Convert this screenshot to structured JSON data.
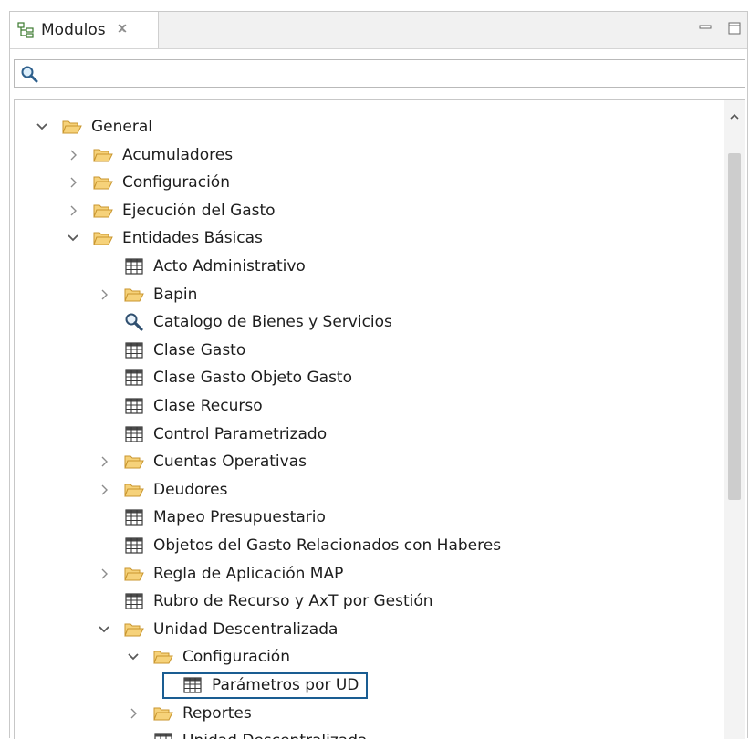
{
  "view": {
    "tab_label": "Modulos",
    "tab_icon": "hierarchy-icon",
    "minimize_icon": "minimize-icon",
    "maximize_icon": "maximize-icon",
    "close_icon": "close-x-icon"
  },
  "search": {
    "value": "",
    "placeholder": "",
    "icon": "magnifier-icon"
  },
  "tree": {
    "nodes": [
      {
        "label": "General",
        "level": 0,
        "icon": "folder-open-icon",
        "expander": "expanded"
      },
      {
        "label": "Acumuladores",
        "level": 1,
        "icon": "folder-open-icon",
        "expander": "collapsed"
      },
      {
        "label": "Configuración",
        "level": 1,
        "icon": "folder-open-icon",
        "expander": "collapsed"
      },
      {
        "label": "Ejecución del Gasto",
        "level": 1,
        "icon": "folder-open-icon",
        "expander": "collapsed"
      },
      {
        "label": "Entidades Básicas",
        "level": 1,
        "icon": "folder-open-icon",
        "expander": "expanded"
      },
      {
        "label": "Acto Administrativo",
        "level": 2,
        "icon": "table-icon",
        "expander": "none"
      },
      {
        "label": "Bapin",
        "level": 2,
        "icon": "folder-open-icon",
        "expander": "collapsed"
      },
      {
        "label": "Catalogo de Bienes y Servicios",
        "level": 2,
        "icon": "search-catalog-icon",
        "expander": "none"
      },
      {
        "label": "Clase Gasto",
        "level": 2,
        "icon": "table-icon",
        "expander": "none"
      },
      {
        "label": "Clase Gasto Objeto Gasto",
        "level": 2,
        "icon": "table-icon",
        "expander": "none"
      },
      {
        "label": "Clase Recurso",
        "level": 2,
        "icon": "table-icon",
        "expander": "none"
      },
      {
        "label": "Control Parametrizado",
        "level": 2,
        "icon": "table-icon",
        "expander": "none"
      },
      {
        "label": "Cuentas Operativas",
        "level": 2,
        "icon": "folder-open-icon",
        "expander": "collapsed"
      },
      {
        "label": "Deudores",
        "level": 2,
        "icon": "folder-open-icon",
        "expander": "collapsed"
      },
      {
        "label": "Mapeo Presupuestario",
        "level": 2,
        "icon": "table-icon",
        "expander": "none"
      },
      {
        "label": "Objetos del Gasto Relacionados con Haberes",
        "level": 2,
        "icon": "table-icon",
        "expander": "none"
      },
      {
        "label": "Regla de Aplicación MAP",
        "level": 2,
        "icon": "folder-open-icon",
        "expander": "collapsed"
      },
      {
        "label": "Rubro de Recurso y AxT por Gestión",
        "level": 2,
        "icon": "table-icon",
        "expander": "none"
      },
      {
        "label": "Unidad Descentralizada",
        "level": 2,
        "icon": "folder-open-icon",
        "expander": "expanded"
      },
      {
        "label": "Configuración",
        "level": 3,
        "icon": "folder-open-icon",
        "expander": "expanded"
      },
      {
        "label": "Parámetros por UD",
        "level": 4,
        "icon": "table-icon",
        "expander": "none",
        "selected": true
      },
      {
        "label": "Reportes",
        "level": 3,
        "icon": "folder-open-icon",
        "expander": "collapsed"
      },
      {
        "label": "Unidad Descentralizada",
        "level": 3,
        "icon": "table-icon",
        "expander": "none"
      }
    ]
  },
  "scrollbar": {
    "up_icon": "chevron-up-icon",
    "position": 0.1
  },
  "colors": {
    "selection_border": "#1a5d92",
    "folder_fill": "#f6d27a",
    "folder_stroke": "#c9962e",
    "chevron": "#5a5a5a"
  }
}
